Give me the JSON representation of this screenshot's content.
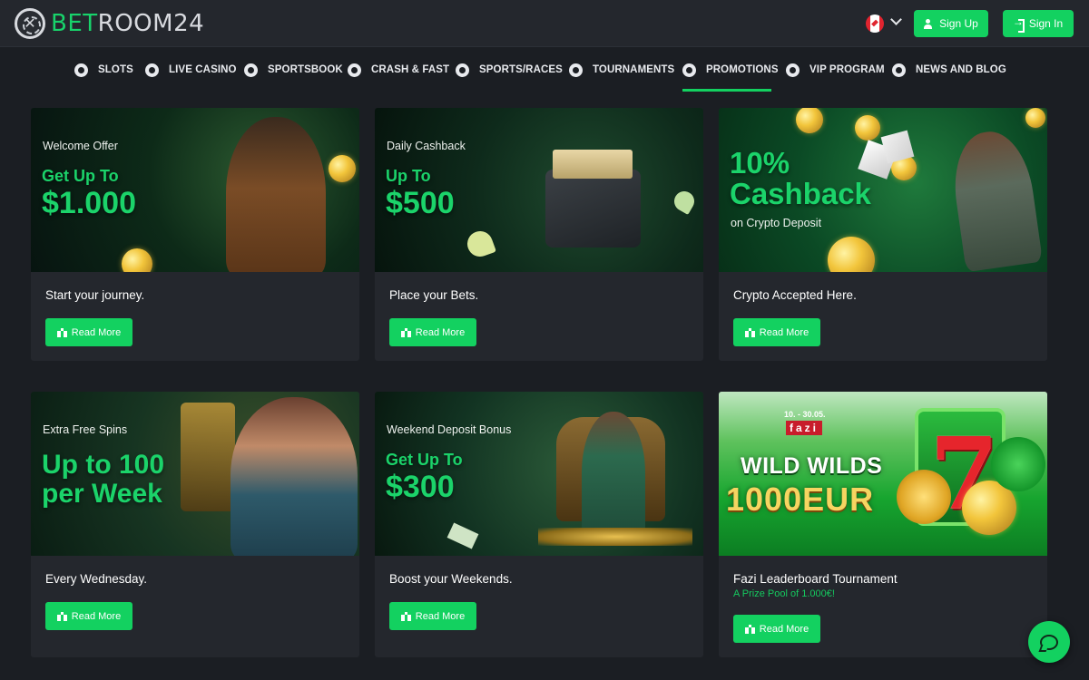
{
  "header": {
    "logo_prefix": "BET",
    "logo_suffix": "ROOM24",
    "signup_label": "Sign Up",
    "signin_label": "Sign In",
    "locale_flag": "canada-flag"
  },
  "nav": {
    "items": [
      {
        "label": "SLOTS",
        "icon": "slots-icon"
      },
      {
        "label": "LIVE CASINO",
        "icon": "live-casino-icon"
      },
      {
        "label": "SPORTSBOOK",
        "icon": "sportsbook-icon"
      },
      {
        "label": "CRASH & FAST",
        "icon": "rocket-icon"
      },
      {
        "label": "SPORTS/RACES",
        "icon": "sports-races-icon"
      },
      {
        "label": "TOURNAMENTS",
        "icon": "trophy-icon"
      },
      {
        "label": "PROMOTIONS",
        "icon": "gift-icon"
      },
      {
        "label": "VIP PROGRAM",
        "icon": "crown-icon"
      },
      {
        "label": "NEWS AND BLOG",
        "icon": "megaphone-icon"
      }
    ],
    "active": "PROMOTIONS"
  },
  "promos": [
    {
      "banner_sub": "Welcome Offer",
      "banner_line1": "Get Up To",
      "banner_line2": "$1.000",
      "title": "Start your journey.",
      "subtitle": "",
      "button": "Read More"
    },
    {
      "banner_sub": "Daily Cashback",
      "banner_line1": "Up To",
      "banner_line2": "$500",
      "title": "Place your Bets.",
      "subtitle": "",
      "button": "Read More"
    },
    {
      "banner_sub": "on Crypto Deposit",
      "banner_line1": "10%",
      "banner_line2": "Cashback",
      "title": "Crypto Accepted Here.",
      "subtitle": "",
      "button": "Read More"
    },
    {
      "banner_sub": "Extra Free Spins",
      "banner_line1": "Up to 100",
      "banner_line2": "per Week",
      "title": "Every Wednesday.",
      "subtitle": "",
      "button": "Read More"
    },
    {
      "banner_sub": "Weekend Deposit Bonus",
      "banner_line1": "Get Up To",
      "banner_line2": "$300",
      "title": "Boost your Weekends.",
      "subtitle": "",
      "button": "Read More"
    },
    {
      "banner_sub": "10. - 30.05.",
      "banner_brand": "fazi",
      "banner_line1": "WILD WILDS",
      "banner_line2": "1000EUR",
      "title": "Fazi Leaderboard Tournament",
      "subtitle": "A Prize Pool of 1.000€!",
      "button": "Read More"
    }
  ],
  "colors": {
    "accent": "#13d160",
    "background": "#1b1e23",
    "card": "#24272d"
  }
}
